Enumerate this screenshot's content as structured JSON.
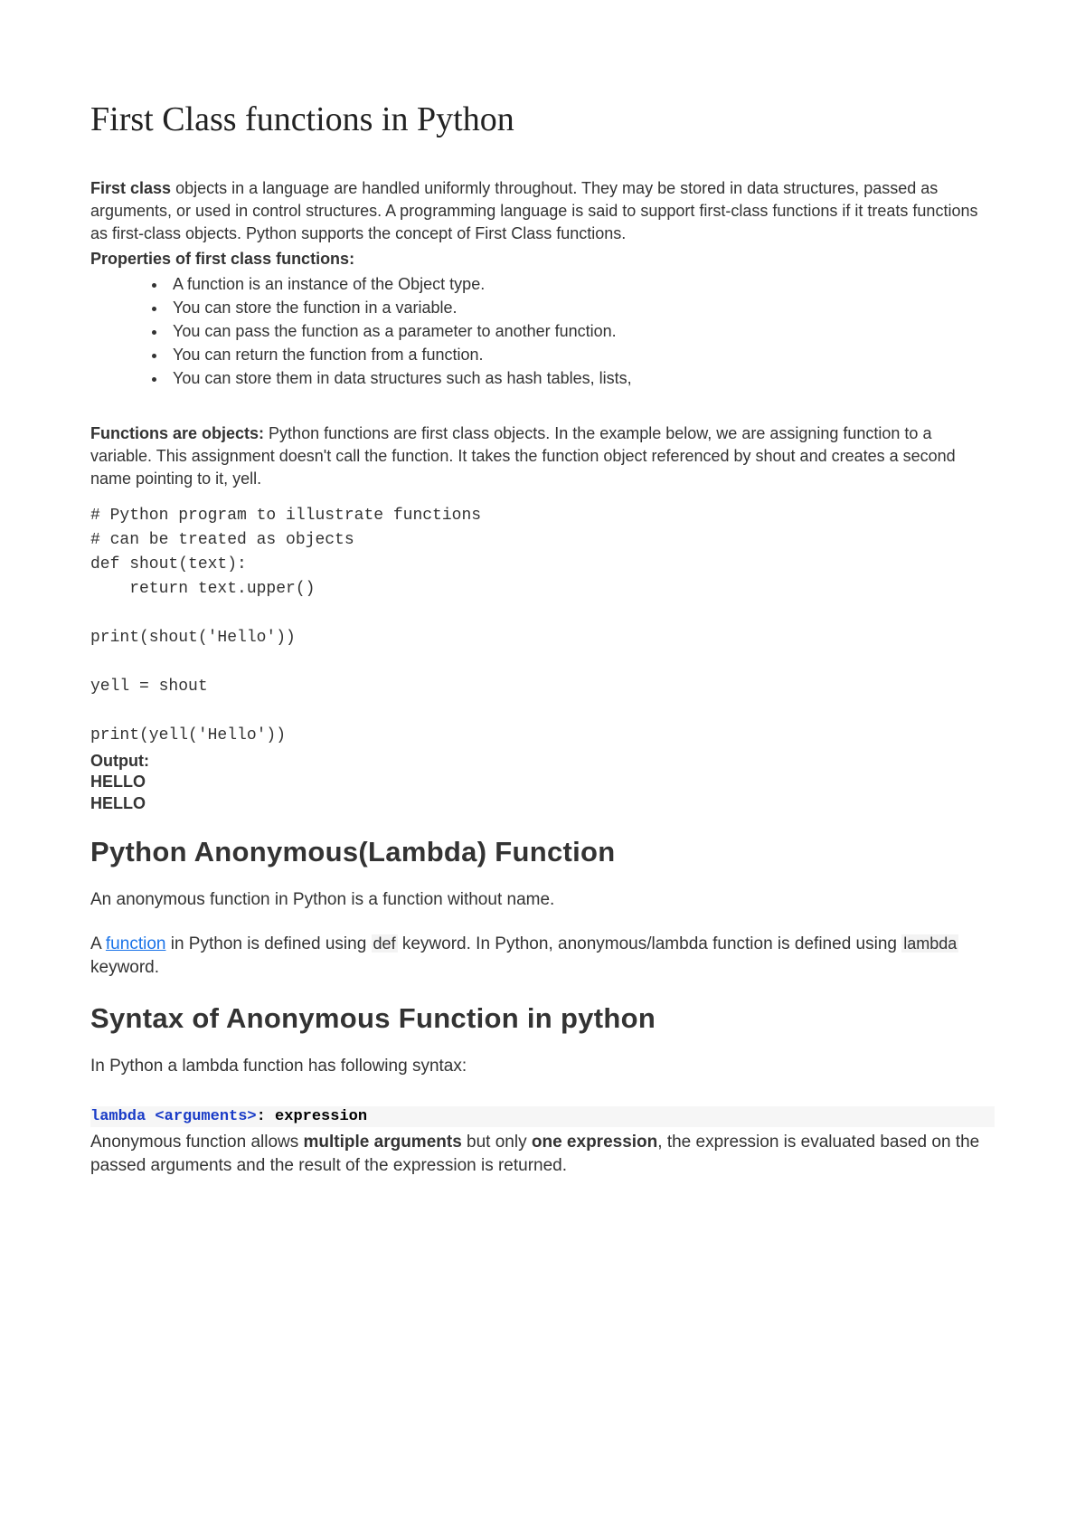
{
  "title": "First Class functions in Python",
  "intro": {
    "bold_lead": "First class",
    "text": " objects in a language are handled uniformly throughout. They may be stored in data structures, passed as arguments, or used in control structures. A programming language is said to support first-class functions if it treats functions as first-class objects. Python supports the concept of First Class functions."
  },
  "properties_header": "Properties of first class functions:",
  "properties": [
    "A function is an instance of the Object type.",
    "You can store the function in a variable.",
    "You can pass the function as a parameter to another function.",
    "You can return the function from a function.",
    "You can store them in data structures such as hash tables, lists,"
  ],
  "functions_objects": {
    "bold_lead": " Functions are objects:",
    "text": " Python functions are first class objects. In the example below, we are assigning function to a variable. This assignment doesn't call the function. It takes the function object referenced by shout and creates a second name pointing to it, yell."
  },
  "code1": "# Python program to illustrate functions\n# can be treated as objects\ndef shout(text):\n    return text.upper()\n\nprint(shout('Hello'))\n\nyell = shout\n\nprint(yell('Hello'))",
  "output_label": "Output:",
  "output_lines": [
    "HELLO",
    "HELLO"
  ],
  "h2_lambda": "Python Anonymous(Lambda) Function",
  "lambda_intro": "An anonymous function in Python is a function without name.",
  "lambda_para_prefix": "A ",
  "lambda_link_text": "function",
  "lambda_para_mid": " in Python is defined using ",
  "lambda_def_kw": "def",
  "lambda_para_mid2": " keyword. In Python, anonymous/lambda function is defined using ",
  "lambda_lambda_kw": "lambda",
  "lambda_para_end": " keyword.",
  "h2_syntax": "Syntax of Anonymous Function in python",
  "syntax_intro": "In Python a lambda function has following syntax:",
  "syntax_kw": "lambda",
  "syntax_args": " <arguments>",
  "syntax_rest": ": expression",
  "after_syntax_prefix": "Anonymous function allows ",
  "after_syntax_bold1": "multiple arguments",
  "after_syntax_mid": " but only ",
  "after_syntax_bold2": "one expression",
  "after_syntax_end": ", the expression is evaluated based on the passed arguments and the result of the expression is returned."
}
